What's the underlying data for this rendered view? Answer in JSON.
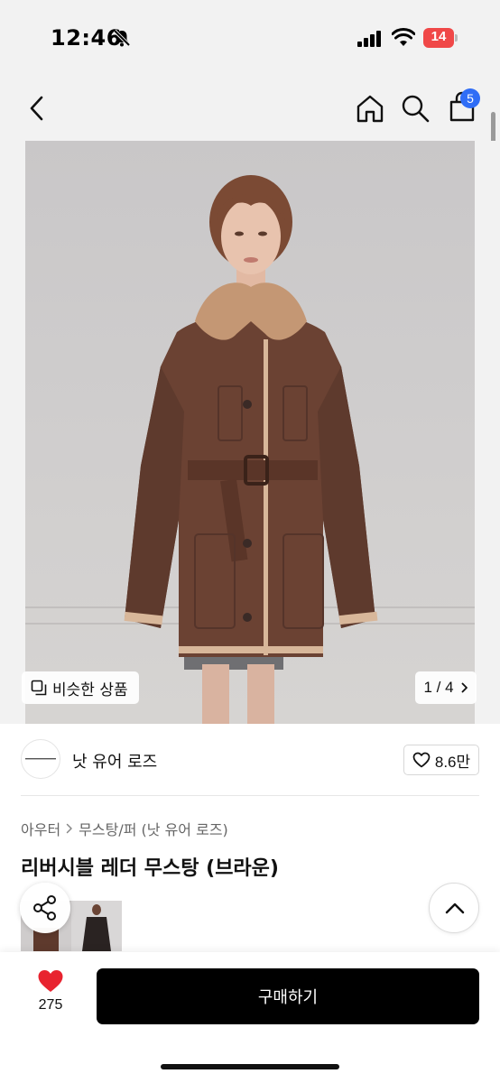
{
  "status": {
    "time": "12:46",
    "battery": "14"
  },
  "nav": {
    "cart_count": "5",
    "icons": [
      "chevron-left-icon",
      "home-icon",
      "search-icon",
      "shopping-bag-icon"
    ]
  },
  "gallery": {
    "similar_label": "비슷한 상품",
    "page_indicator": "1 / 4"
  },
  "brand": {
    "name": "낫 유어 로즈",
    "likes": "8.6만"
  },
  "breadcrumb": {
    "category": "아우터",
    "subcategory": "무스탕/퍼 (낫 유어 로즈)"
  },
  "product": {
    "title": "리버시블 레더 무스탕 (브라운)"
  },
  "bottom": {
    "wish_count": "275",
    "buy_label": "구매하기"
  },
  "colors": {
    "accent_badge": "#2f6df6",
    "wish_heart": "#e8232f",
    "buy_button": "#000000",
    "battery": "#f04848"
  }
}
